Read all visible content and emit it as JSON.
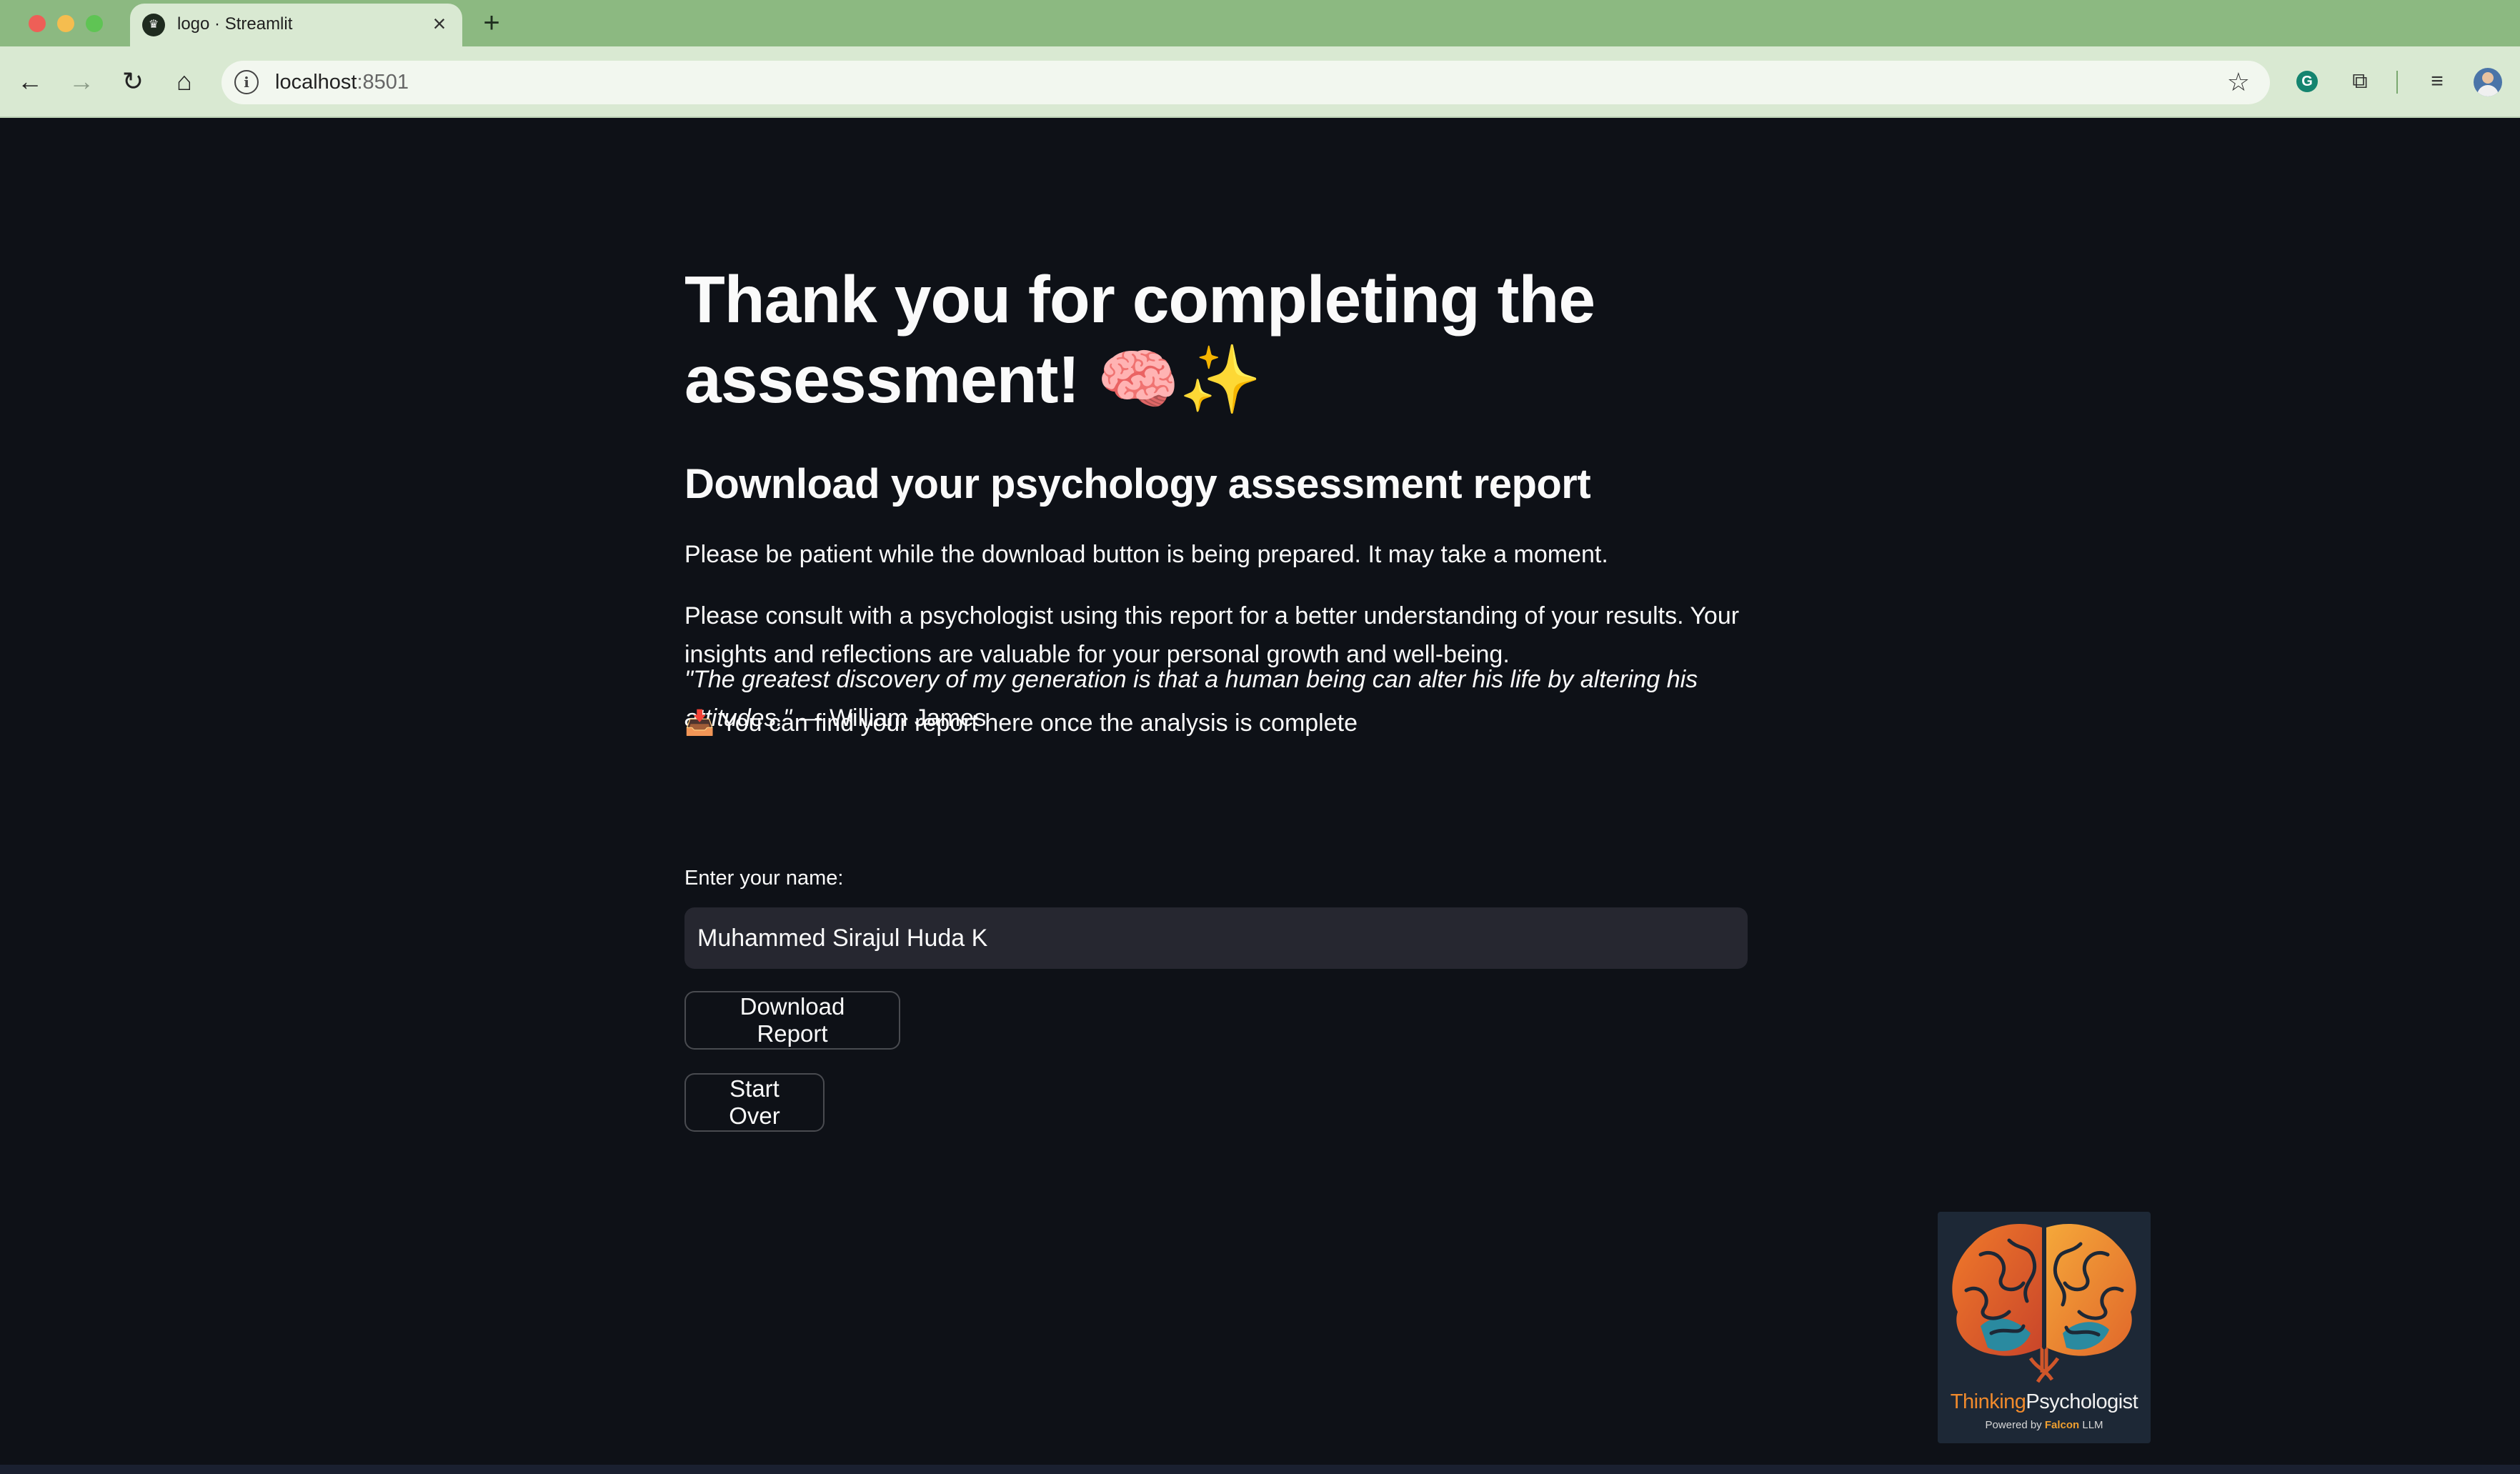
{
  "browser": {
    "tab_title": "logo · Streamlit",
    "url_host": "localhost",
    "url_port": ":8501"
  },
  "main": {
    "title": "Thank you for completing the assessment! 🧠✨",
    "subtitle": "Download your psychology assessment report",
    "patience_text": "Please be patient while the download button is being prepared. It may take a moment.",
    "consult_text": "Please consult with a psychologist using this report for a better understanding of your results. Your insights and reflections are valuable for your personal growth and well-being.",
    "quote_text": "\"The greatest discovery of my generation is that a human being can alter his life by altering his attitudes.\"",
    "quote_author": " — William James",
    "report_hint": "📥 You can find your report here once the analysis is complete",
    "name_label": "Enter your name:",
    "name_value": "Muhammed Sirajul Huda K",
    "download_button": "Download Report",
    "start_over_button": "Start Over"
  },
  "logo": {
    "brand_part1": "Thinking",
    "brand_part2": "Psychologist",
    "powered_prefix": "Powered by ",
    "powered_brand": "Falcon",
    "powered_suffix": " LLM"
  },
  "colors": {
    "tab_bar": "#8cb981",
    "toolbar": "#d9e9d2",
    "app_background": "#0e1117",
    "input_background": "#262730",
    "text": "#fafafa",
    "logo_orange": "#f08a2c"
  }
}
